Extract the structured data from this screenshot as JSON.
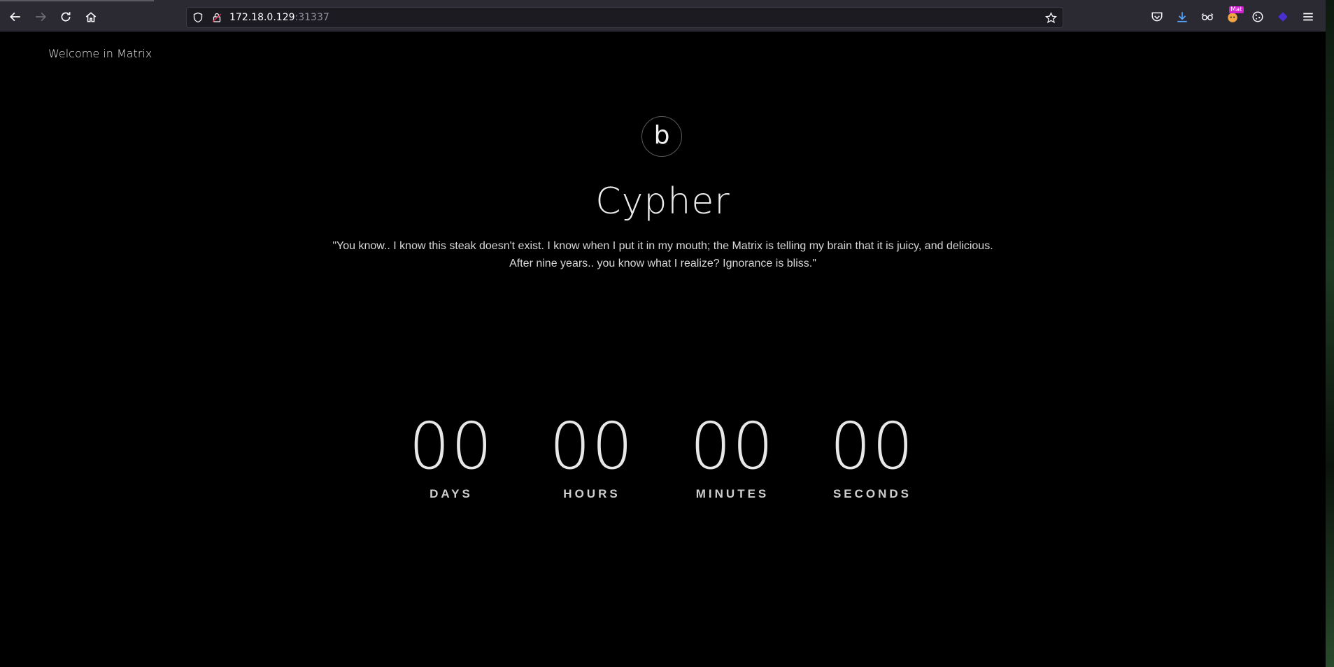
{
  "browser": {
    "url_host": "172.18.0.129",
    "url_port": ":31337",
    "extension_badge": "Mat"
  },
  "page": {
    "brand": "Welcome in Matrix",
    "logo_letter": "b",
    "title": "Cypher",
    "quote_line1": "\"You know.. I know this steak doesn't exist. I know when I put it in my mouth; the Matrix is telling my brain that it is juicy, and delicious.",
    "quote_line2": "After nine years.. you know what I realize? Ignorance is bliss.\""
  },
  "countdown": [
    {
      "value": "00",
      "label": "DAYS"
    },
    {
      "value": "00",
      "label": "HOURS"
    },
    {
      "value": "00",
      "label": "MINUTES"
    },
    {
      "value": "00",
      "label": "SECONDS"
    }
  ],
  "colors": {
    "background": "#000000",
    "toolbar": "#2b2a33",
    "text": "#e8e8e8"
  }
}
